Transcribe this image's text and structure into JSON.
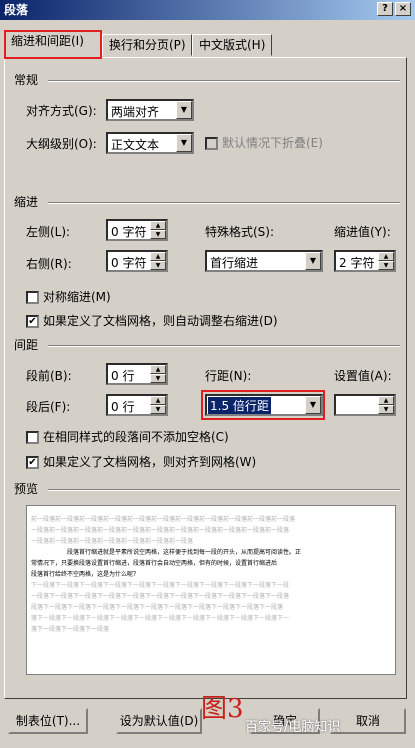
{
  "window": {
    "title": "段落",
    "help_btn": "?",
    "close_btn": "×"
  },
  "tabs": [
    {
      "label": "缩进和间距(I)",
      "active": true
    },
    {
      "label": "换行和分页(P)",
      "active": false
    },
    {
      "label": "中文版式(H)",
      "active": false
    }
  ],
  "general": {
    "section": "常规",
    "alignment_label": "对齐方式(G):",
    "alignment_value": "两端对齐",
    "outline_label": "大纲级别(O):",
    "outline_value": "正文文本",
    "collapse_label": "默认情况下折叠(E)"
  },
  "indent": {
    "section": "缩进",
    "left_label": "左侧(L):",
    "left_value": "0 字符",
    "right_label": "右侧(R):",
    "right_value": "0 字符",
    "special_label": "特殊格式(S):",
    "special_value": "首行缩进",
    "by_label": "缩进值(Y):",
    "by_value": "2 字符",
    "mirror_label": "对称缩进(M)",
    "autoadjust_label": "如果定义了文档网格，则自动调整右缩进(D)"
  },
  "spacing": {
    "section": "间距",
    "before_label": "段前(B):",
    "before_value": "0 行",
    "after_label": "段后(F):",
    "after_value": "0 行",
    "line_label": "行距(N):",
    "line_value": "1.5 倍行距",
    "at_label": "设置值(A):",
    "at_value": "",
    "no_space_label": "在相同样式的段落间不添加空格(C)",
    "snap_label": "如果定义了文档网格，则对齐到网格(W)"
  },
  "preview": {
    "section": "预览",
    "prev_lines": [
      "前一段落前一段落前一段落前一段落前一段落前一段落前一段落前一段落前一段落前一段落前一段落",
      "一段落前一段落前一段落前一段落前一段落前一段落前一段落前一段落前一段落前一段落前一段落",
      "一段落前一段落前一段落前一段落前一段落前一段落前一段落"
    ],
    "main_lines": [
      "段落首行缩进就是平素所说空两格，这样便于找到每一段的开头，从而提高可阅读性。正",
      "常情况下，只要换段落设置首行缩进，段落首行会自动空两格，但有的时候，设置首行缩进后",
      "段落首行给终不空两格，这是为什么呢？"
    ],
    "next_lines": [
      "下一段落下一段落下一段落下一段落下一段落下一段落下一段落下一段落下一段落下一段落下一段",
      "一段落下一段落下一段落下一段落下一段落下一段落下一段落下一段落下一段落下一段落下一段落",
      "段落下一段落下一段落下一段落下一段落下一段落下一段落下一段落下一段落下一段落下一段落",
      "落下一段落下一段落下一段落下一段落下一段落下一段落下一段落下一段落下一段落下一段落下一",
      "落下一段落下一段落下一段落"
    ]
  },
  "buttons": {
    "tabs": "制表位(T)...",
    "default": "设为默认值(D)",
    "ok": "确定",
    "cancel": "取消"
  },
  "annotation": {
    "figure_label": "图3"
  },
  "watermark": {
    "text": "百家号/电脑知识"
  }
}
